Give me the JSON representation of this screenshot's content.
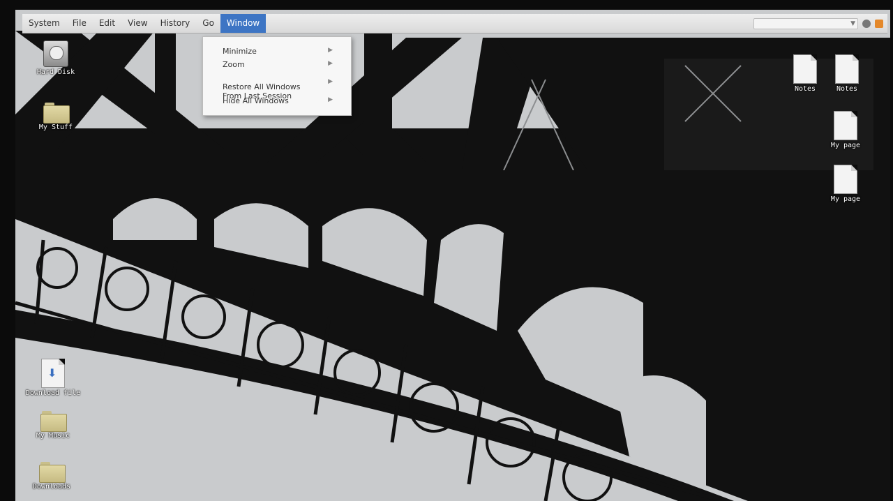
{
  "menubar": {
    "items": [
      "System",
      "File",
      "Edit",
      "View",
      "History",
      "Go",
      "Window"
    ],
    "active": "Window"
  },
  "window_menu": {
    "items": [
      {
        "label": "Minimize",
        "submenu": true
      },
      {
        "label": "Zoom",
        "submenu": true
      },
      {
        "label": "Restore All Windows\nFrom Last Session",
        "submenu": true
      },
      {
        "label": "Hide All Windows",
        "submenu": true
      }
    ]
  },
  "desktop_icons_left": [
    {
      "label": "Hard Disk",
      "icon": "hard-disk-icon"
    },
    {
      "label": "My Stuff",
      "icon": "folder-icon"
    },
    {
      "label": "Download file",
      "icon": "download-document-icon"
    },
    {
      "label": "My Music",
      "icon": "music-folder-icon"
    },
    {
      "label": "Downloads",
      "icon": "downloads-folder-icon"
    }
  ],
  "desktop_icons_right": [
    {
      "label": "Notes",
      "icon": "document-icon"
    },
    {
      "label": "Notes",
      "icon": "document-icon"
    },
    {
      "label": "My page",
      "icon": "document-icon"
    },
    {
      "label": "My page",
      "icon": "document-icon"
    }
  ],
  "colors": {
    "menu_highlight": "#3d75c4",
    "wallpaper_sky": "#c9cbcd",
    "ironwork": "#111111"
  }
}
